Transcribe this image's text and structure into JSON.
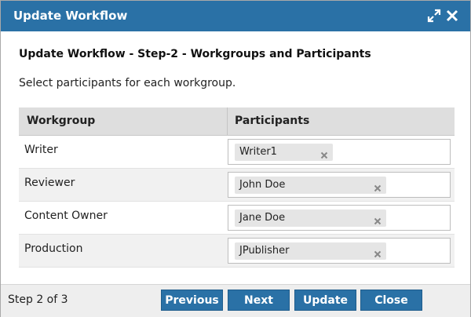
{
  "window": {
    "title": "Update Workflow"
  },
  "heading": "Update Workflow - Step-2 - Workgroups and Participants",
  "instruction": "Select participants for each workgroup.",
  "table": {
    "columns": [
      "Workgroup",
      "Participants"
    ],
    "rows": [
      {
        "workgroup": "Writer",
        "participant": "Writer1"
      },
      {
        "workgroup": "Reviewer",
        "participant": "John Doe"
      },
      {
        "workgroup": "Content Owner",
        "participant": "Jane Doe"
      },
      {
        "workgroup": "Production",
        "participant": "JPublisher"
      }
    ]
  },
  "footer": {
    "step": "Step 2 of 3",
    "buttons": {
      "previous": "Previous",
      "next": "Next",
      "update": "Update",
      "close": "Close"
    }
  },
  "icons": {
    "maximize": "expand-arrows-icon",
    "close": "close-icon",
    "remove": "remove-x-icon"
  },
  "colors": {
    "accent": "#2a71a6",
    "header_bg": "#dedede",
    "chip_bg": "#e5e5e5"
  }
}
